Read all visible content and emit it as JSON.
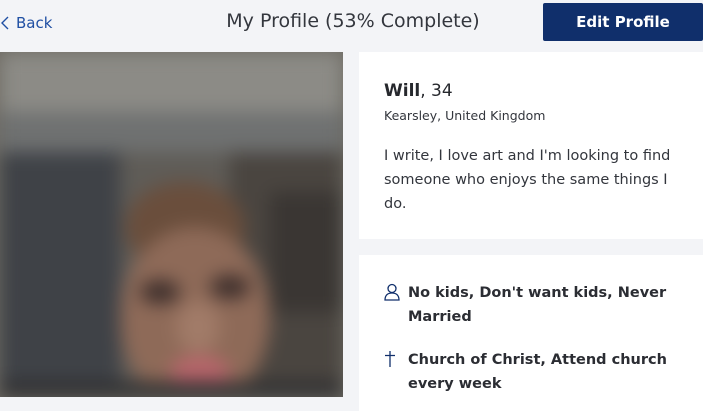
{
  "header": {
    "back_label": "Back",
    "title": "My Profile (53% Complete)",
    "edit_button_label": "Edit Profile"
  },
  "profile": {
    "name": "Will",
    "age_text": ", 34",
    "location": "Kearsley, United Kingdom",
    "bio": "I write, I love art and I'm looking to find someone who enjoys the same things I do."
  },
  "details": [
    {
      "icon": "person-icon",
      "text": "No kids, Don't want kids, Never Married"
    },
    {
      "icon": "cross-icon",
      "text": "Church of Christ, Attend church every week"
    }
  ],
  "colors": {
    "accent": "#102f6b",
    "link": "#1f4fa3",
    "background": "#f3f4f7",
    "card": "#ffffff"
  }
}
